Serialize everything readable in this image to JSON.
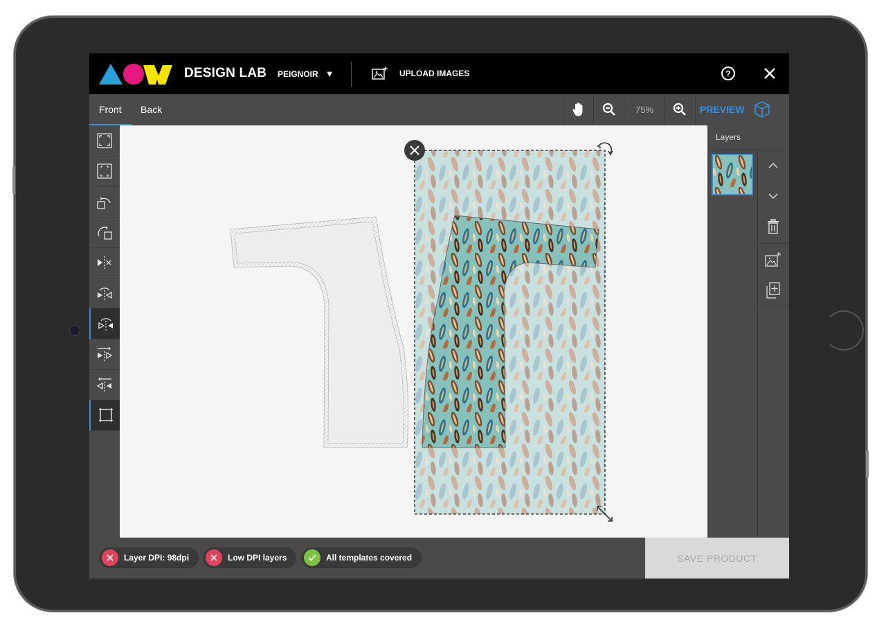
{
  "app": {
    "title": "DESIGN LAB",
    "product_select": "PEIGNOIR",
    "upload_label": "UPLOAD IMAGES",
    "brand_colors": {
      "triangle": "#2b9fd8",
      "circle": "#e6197e",
      "w": "#f5e400"
    }
  },
  "tabs": [
    {
      "label": "Front",
      "active": true
    },
    {
      "label": "Back",
      "active": false
    }
  ],
  "toolbar": {
    "zoom_level": "75%",
    "preview_label": "PREVIEW",
    "accent": "#3a8fd6"
  },
  "left_tools": [
    "fit-width-icon",
    "fit-height-icon",
    "rotate-left-icon",
    "rotate-right-icon",
    "flip-horizontal-icon",
    "mirror-rotate-icon",
    "mirror-rotate-alt-icon",
    "align-right-icon",
    "align-left-icon",
    "crop-frame-icon"
  ],
  "layers": {
    "title": "Layers"
  },
  "status": [
    {
      "label": "Layer DPI: 98dpi",
      "ok": false
    },
    {
      "label": "Low DPI layers",
      "ok": false
    },
    {
      "label": "All templates covered",
      "ok": true
    }
  ],
  "status_colors": {
    "error": "#e0445c",
    "ok": "#7cc242"
  },
  "save_label": "SAVE PRODUCT"
}
